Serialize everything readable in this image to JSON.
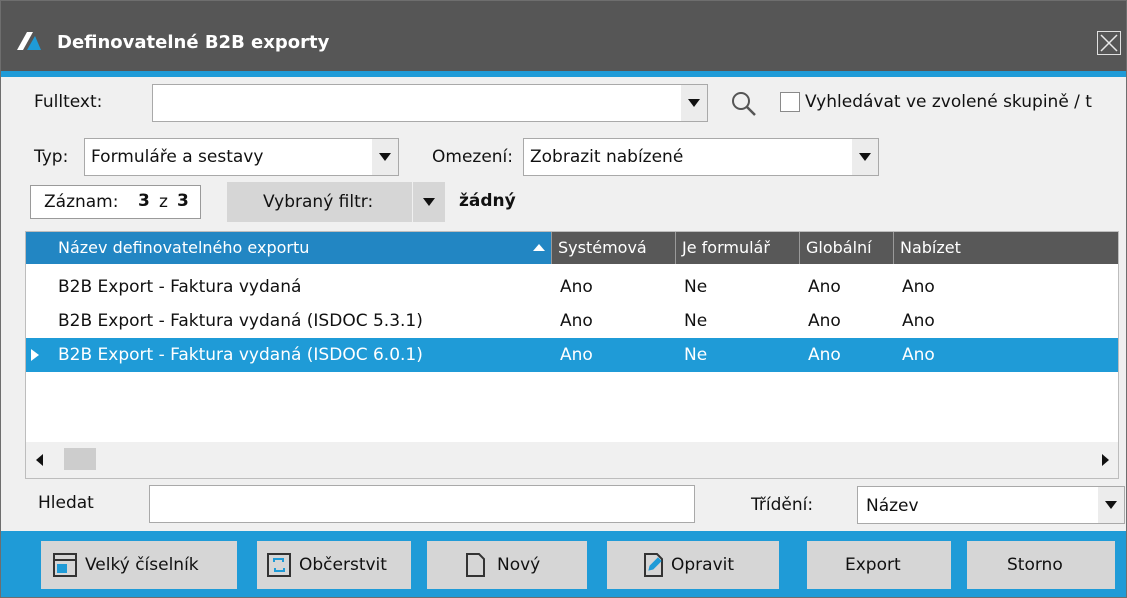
{
  "window": {
    "title": "Definovatelné B2B exporty"
  },
  "search": {
    "fulltext_label": "Fulltext:",
    "fulltext_value": "",
    "group_search_label": "Vyhledávat ve zvolené skupině / t",
    "group_search_checked": false
  },
  "filters": {
    "type_label": "Typ:",
    "type_value": "Formuláře a sestavy",
    "restriction_label": "Omezení:",
    "restriction_value": "Zobrazit nabízené"
  },
  "record": {
    "label": "Záznam:",
    "current": "3",
    "separator": "z",
    "total": "3",
    "filter_button": "Vybraný filtr:",
    "filter_value": "žádný"
  },
  "grid": {
    "columns": [
      "Název definovatelného exportu",
      "Systémová",
      "Je formulář",
      "Globální",
      "Nabízet"
    ],
    "sorted_column_index": 0,
    "rows": [
      {
        "name": "B2B Export - Faktura vydaná",
        "system": "Ano",
        "form": "Ne",
        "global": "Ano",
        "offer": "Ano",
        "selected": false
      },
      {
        "name": "B2B Export - Faktura vydaná (ISDOC 5.3.1)",
        "system": "Ano",
        "form": "Ne",
        "global": "Ano",
        "offer": "Ano",
        "selected": false
      },
      {
        "name": "B2B Export - Faktura vydaná (ISDOC 6.0.1)",
        "system": "Ano",
        "form": "Ne",
        "global": "Ano",
        "offer": "Ano",
        "selected": true
      }
    ]
  },
  "bottom": {
    "find_label": "Hledat",
    "find_value": "",
    "sort_label": "Třídění:",
    "sort_value": "Název"
  },
  "buttons": {
    "big_list": "Velký číselník",
    "refresh": "Občerstvit",
    "new": "Nový",
    "edit": "Opravit",
    "export": "Export",
    "cancel": "Storno"
  },
  "colors": {
    "accent": "#1f9bd7",
    "title_bar": "#565656",
    "header": "#585858",
    "sorted_header": "#2286c3"
  }
}
